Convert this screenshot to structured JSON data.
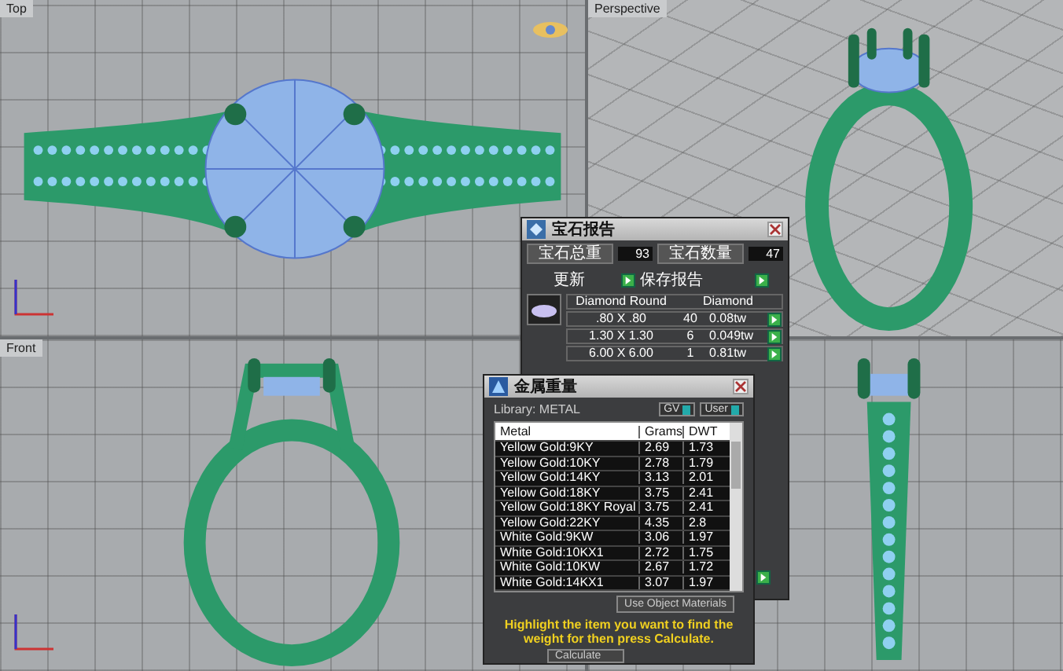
{
  "viewports": [
    {
      "kind": "top",
      "label": "Top"
    },
    {
      "kind": "perspective",
      "label": "Perspective"
    },
    {
      "kind": "front",
      "label": "Front"
    },
    {
      "kind": "side"
    }
  ],
  "gem_report": {
    "title": "宝石报告",
    "total_weight_label": "宝石总重",
    "total_weight": "93",
    "count_label": "宝石数量",
    "count": "47",
    "update_button": "更新",
    "save_button": "保存报告",
    "columns": [
      "Diamond Round",
      "Diamond"
    ],
    "rows": [
      {
        "size": ".80 X .80",
        "count": "40",
        "weight": "0.08tw"
      },
      {
        "size": "1.30 X 1.30",
        "count": "6",
        "weight": "0.049tw"
      },
      {
        "size": "6.00 X 6.00",
        "count": "1",
        "weight": "0.81tw"
      }
    ]
  },
  "metal_weight": {
    "title": "金属重量",
    "library": "Library: METAL",
    "tag_buttons": [
      "GV",
      "User"
    ],
    "columns": [
      "Metal",
      "Grams",
      "DWT"
    ],
    "rows": [
      {
        "metal": "Yellow Gold:9KY",
        "grams": "2.69",
        "dwt": "1.73"
      },
      {
        "metal": "Yellow Gold:10KY",
        "grams": "2.78",
        "dwt": "1.79"
      },
      {
        "metal": "Yellow Gold:14KY",
        "grams": "3.13",
        "dwt": "2.01"
      },
      {
        "metal": "Yellow Gold:18KY",
        "grams": "3.75",
        "dwt": "2.41"
      },
      {
        "metal": "Yellow Gold:18KY Royal",
        "grams": "3.75",
        "dwt": "2.41"
      },
      {
        "metal": "Yellow Gold:22KY",
        "grams": "4.35",
        "dwt": "2.8"
      },
      {
        "metal": "White Gold:9KW",
        "grams": "3.06",
        "dwt": "1.97"
      },
      {
        "metal": "White Gold:10KX1",
        "grams": "2.72",
        "dwt": "1.75"
      },
      {
        "metal": "White Gold:10KW",
        "grams": "2.67",
        "dwt": "1.72"
      },
      {
        "metal": "White Gold:14KX1",
        "grams": "3.07",
        "dwt": "1.97"
      }
    ],
    "materials_option": "Use Object Materials",
    "hint": "Highlight the item you want to find the weight for then press Calculate.",
    "calculate_button": "Calculate"
  }
}
